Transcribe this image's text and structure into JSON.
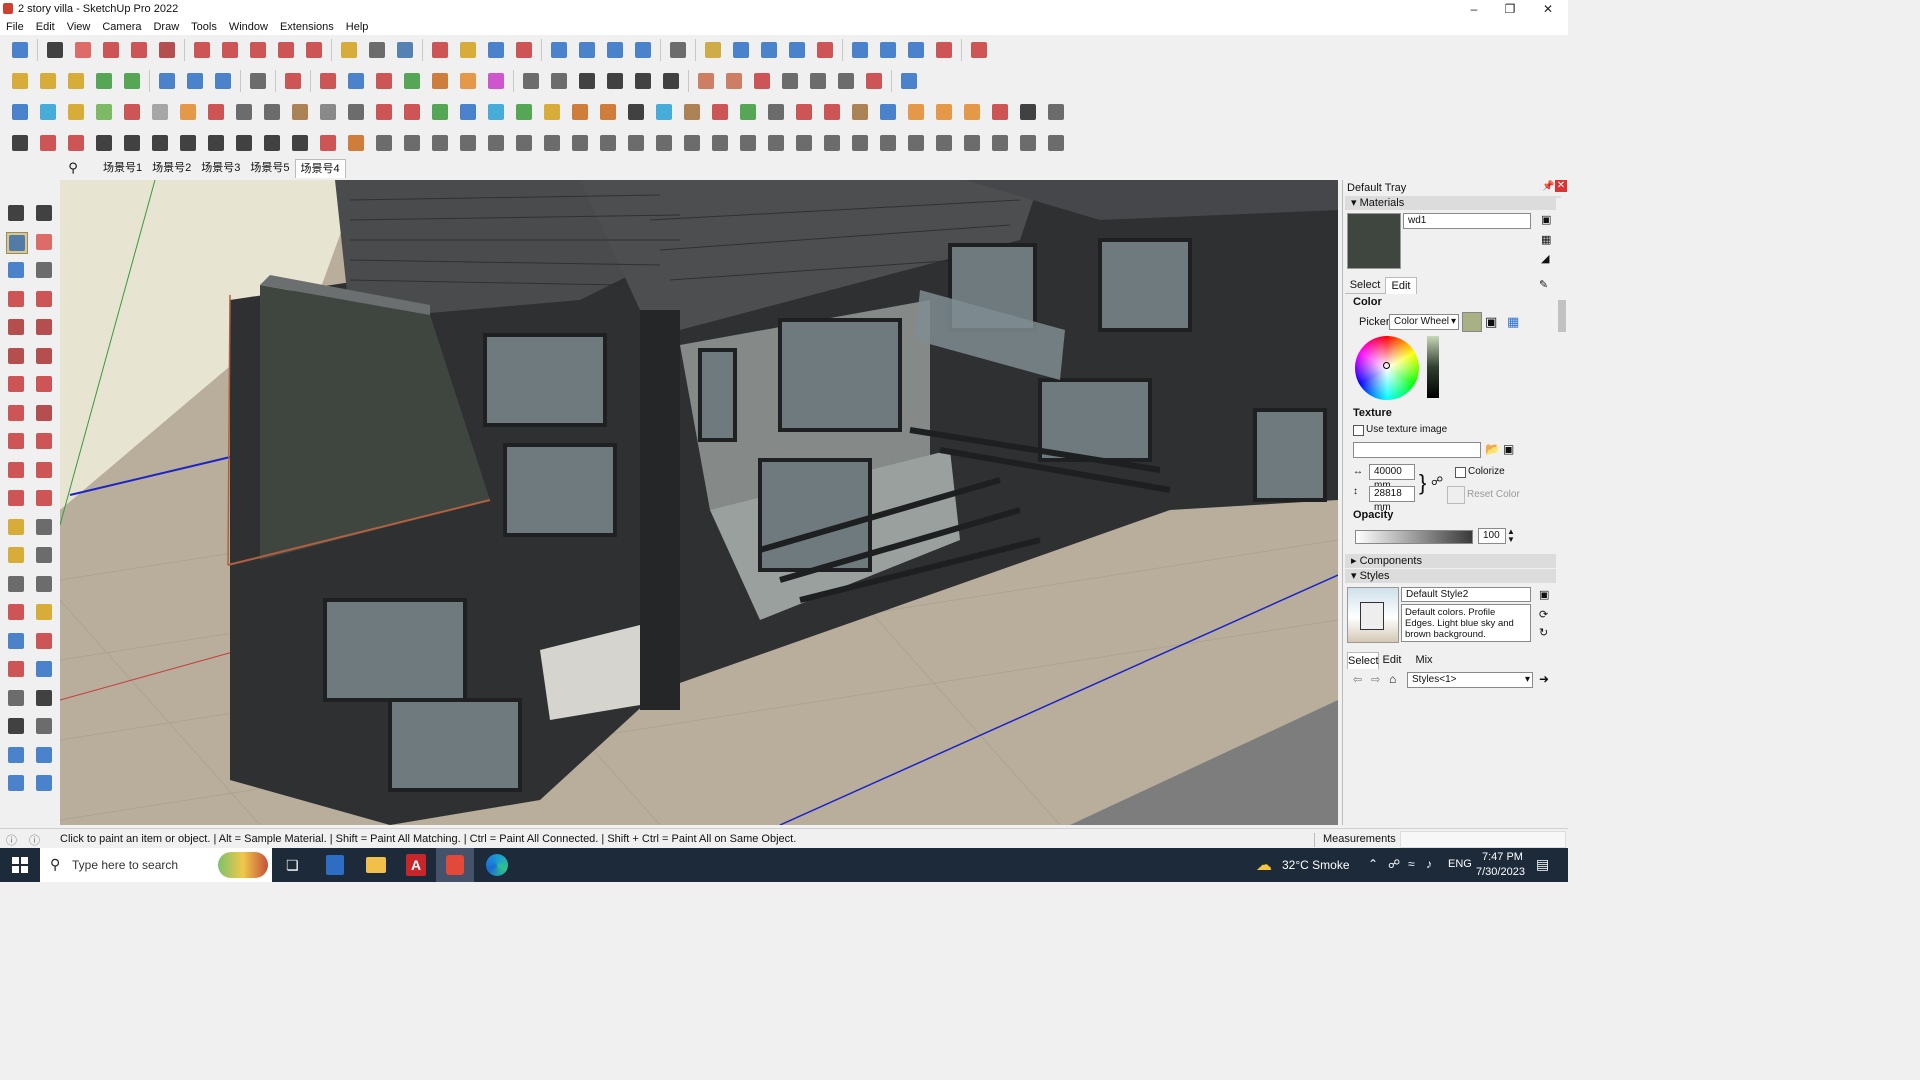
{
  "window": {
    "title": "2 story villa - SketchUp Pro 2022"
  },
  "menu": [
    "File",
    "Edit",
    "View",
    "Camera",
    "Draw",
    "Tools",
    "Window",
    "Extensions",
    "Help"
  ],
  "scenes": {
    "search_icon": "search-icon",
    "tabs": [
      "场景号1",
      "场景号2",
      "场景号3",
      "场景号5",
      "场景号4"
    ],
    "active": "场景号4"
  },
  "tray": {
    "title": "Default Tray",
    "materials": {
      "header": "Materials",
      "name": "wd1",
      "swatch_color": "#3f4640",
      "tabs": [
        "Select",
        "Edit"
      ],
      "color_label": "Color",
      "picker_label": "Picker:",
      "picker_value": "Color Wheel",
      "texture_label": "Texture",
      "use_texture_label": "Use texture image",
      "width": "40000 mm",
      "height": "28818 mm",
      "colorize_label": "Colorize",
      "reset_color_label": "Reset Color",
      "opacity_label": "Opacity",
      "opacity_value": "100"
    },
    "components": {
      "header": "Components"
    },
    "styles": {
      "header": "Styles",
      "name": "Default Style2",
      "description": "Default colors. Profile Edges. Light blue sky and brown background.",
      "tabs": [
        "Select",
        "Edit",
        "Mix"
      ],
      "collection": "Styles<1>"
    }
  },
  "statusbar": {
    "hint": "Click to paint an item or object. | Alt = Sample Material. | Shift = Paint All Matching. | Ctrl = Paint All Connected. | Shift + Ctrl = Paint All on Same Object.",
    "measurements_label": "Measurements"
  },
  "taskbar": {
    "search_placeholder": "Type here to search",
    "weather": "32°C  Smoke",
    "language": "ENG",
    "time": "7:47 PM",
    "date": "7/30/2023"
  }
}
